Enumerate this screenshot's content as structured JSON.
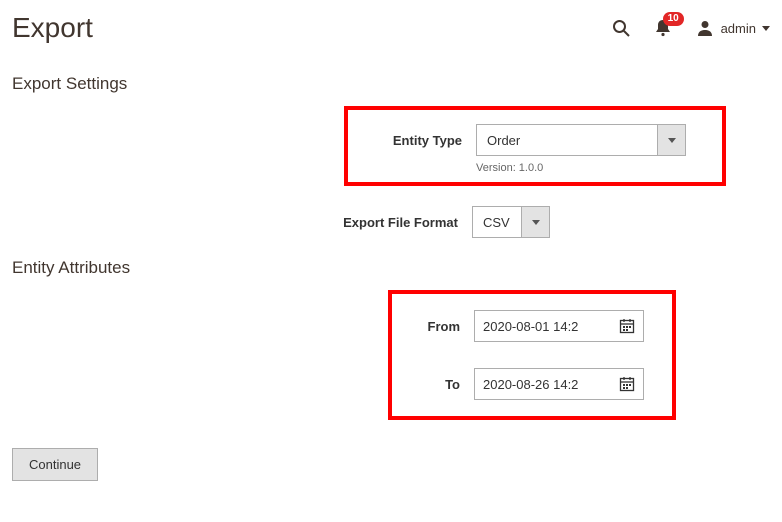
{
  "header": {
    "title": "Export",
    "notification_count": "10",
    "username": "admin"
  },
  "sections": {
    "settings_title": "Export Settings",
    "attributes_title": "Entity Attributes"
  },
  "form": {
    "entity_type": {
      "label": "Entity Type",
      "value": "Order",
      "version": "Version: 1.0.0"
    },
    "file_format": {
      "label": "Export File Format",
      "value": "CSV"
    },
    "from": {
      "label": "From",
      "value": "2020-08-01 14:2"
    },
    "to": {
      "label": "To",
      "value": "2020-08-26 14:2"
    }
  },
  "actions": {
    "continue": "Continue"
  }
}
